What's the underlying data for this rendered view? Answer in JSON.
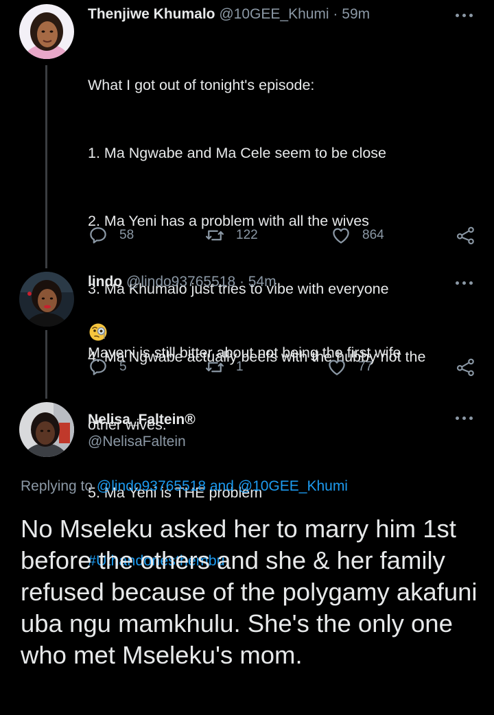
{
  "tweets": [
    {
      "name": "Thenjiwe Khumalo",
      "handle": "@10GEE_Khumi",
      "sep": " · ",
      "time": "59m",
      "lines": [
        "What I got out of tonight's episode:",
        "1. Ma Ngwabe and Ma Cele seem to be close",
        "2. Ma Yeni has a problem with all the wives",
        "3. Ma Khumalo just tries to vibe with everyone",
        "4. Ma Ngwabe actually beefs with the hubby not the",
        "other wives.",
        "5. Ma Yeni is THE problem"
      ],
      "hashtag": "#Uthandonesthembu",
      "replies": "58",
      "retweets": "122",
      "likes": "864"
    },
    {
      "name": "lindo",
      "handle": "@lindo93765518",
      "sep": " · ",
      "time": "54m",
      "text": "Mayeni is still bitter about not being the first wife",
      "emoji": "face-with-monocle-emoji",
      "replies": "5",
      "retweets": "1",
      "likes": "77"
    }
  ],
  "main": {
    "name": "Nelisa_Faltein®",
    "handle": "@NelisaFaltein",
    "replying_prefix": "Replying to ",
    "replying_user1": "@lindo93765518",
    "replying_and": " and ",
    "replying_user2": "@10GEE_Khumi",
    "text": "No Mseleku asked her to marry him 1st before the others and she & her family refused because of the polygamy akafuni uba ngu mamkhulu. She's the only one who met Mseleku's mom."
  },
  "colors": {
    "background": "#000000",
    "text": "#e7e9ea",
    "muted": "#8b98a5",
    "accent": "#1d9bf0",
    "thread_line": "#3a3d41"
  },
  "icons": {
    "reply": "reply-icon",
    "retweet": "retweet-icon",
    "like": "heart-icon",
    "share": "share-icon",
    "more": "more-icon"
  }
}
